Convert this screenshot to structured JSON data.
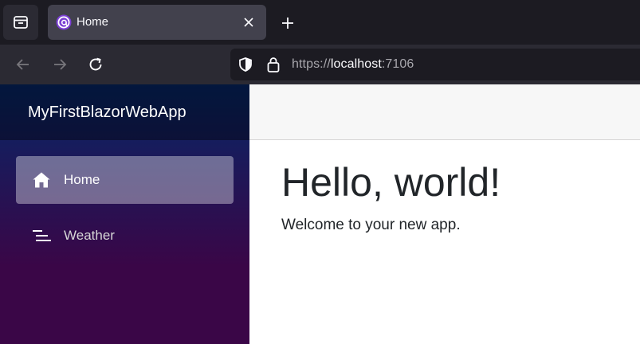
{
  "browser": {
    "tab": {
      "title": "Home"
    },
    "url": {
      "scheme": "https://",
      "host": "localhost",
      "port": ":7106"
    }
  },
  "sidebar": {
    "brand": "MyFirstBlazorWebApp",
    "items": [
      {
        "label": "Home",
        "icon": "home-icon",
        "active": true
      },
      {
        "label": "Weather",
        "icon": "list-icon",
        "active": false
      }
    ]
  },
  "main": {
    "heading": "Hello, world!",
    "text": "Welcome to your new app."
  },
  "colors": {
    "browser_bg": "#1c1b22",
    "toolbar_bg": "#2b2a33",
    "active_tab_bg": "#42414d",
    "sidebar_top": "#052767",
    "sidebar_bottom": "#3a0647",
    "top_row_bg": "#f7f7f7",
    "text": "#212529"
  }
}
